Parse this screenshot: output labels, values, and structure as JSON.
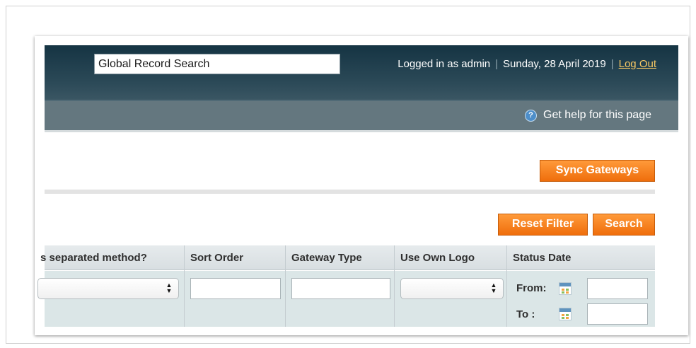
{
  "header": {
    "search_value": "Global Record Search",
    "logged_in_text": "Logged in as admin",
    "separator": "|",
    "date_text": "Sunday, 28 April 2019",
    "logout_label": "Log Out"
  },
  "nav": {
    "help_label": "Get help for this page",
    "help_icon": "?"
  },
  "actions": {
    "sync_label": "Sync Gateways",
    "reset_label": "Reset Filter",
    "search_label": "Search"
  },
  "grid": {
    "columns": [
      "s separated method?",
      "Sort Order",
      "Gateway Type",
      "Use Own Logo",
      "Status Date"
    ],
    "filters": {
      "from_label": "From:",
      "to_label": "To :",
      "sort_order_value": "",
      "gateway_type_value": "",
      "from_value": "",
      "to_value": ""
    }
  },
  "colors": {
    "header_dark": "#153443",
    "nav_gray": "#64777f",
    "button_orange": "#f17a1a",
    "logout_link": "#f7c863",
    "filter_row": "#dbe6e7"
  },
  "icons": [
    "help-icon",
    "calendar-icon",
    "select-arrows-icon"
  ]
}
